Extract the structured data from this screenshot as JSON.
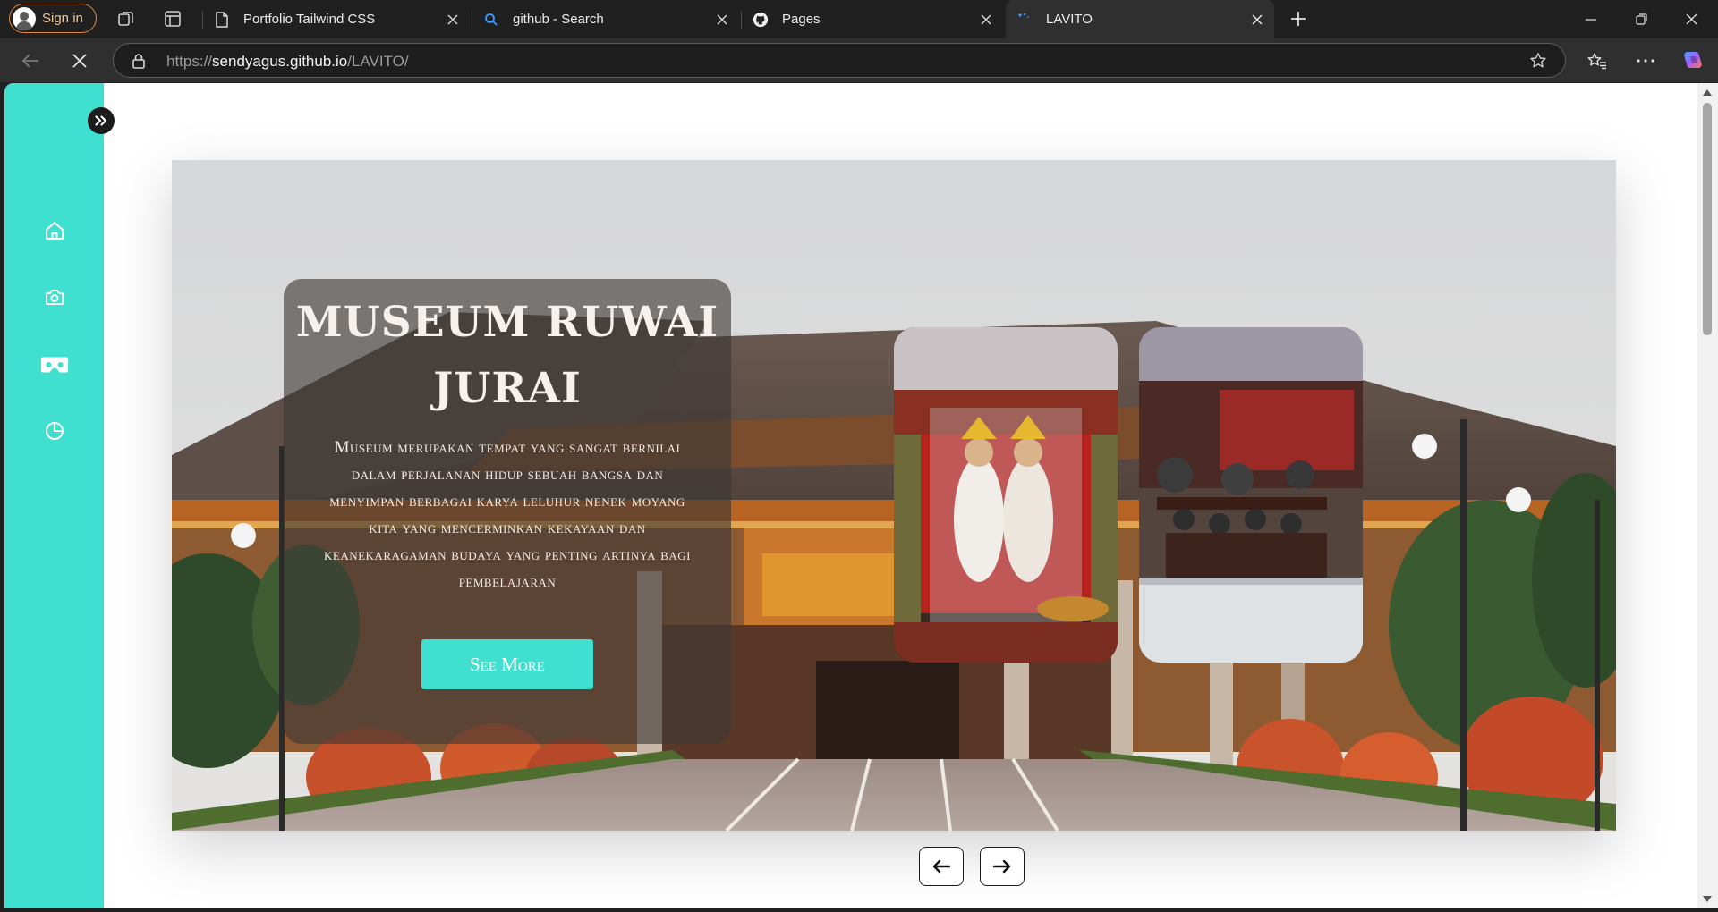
{
  "browser": {
    "signin_label": "Sign in",
    "tabs": [
      {
        "title": "Portfolio Tailwind CSS",
        "favicon": "document-icon"
      },
      {
        "title": "github - Search",
        "favicon": "search-icon"
      },
      {
        "title": "Pages",
        "favicon": "github-icon"
      },
      {
        "title": "LAVITO",
        "favicon": "loading-icon"
      }
    ],
    "url_scheme": "https://",
    "url_host": "sendyagus.github.io",
    "url_path": "/LAVITO/"
  },
  "sidebar": {
    "accent": "#40e0d0",
    "items": [
      {
        "icon": "home-icon"
      },
      {
        "icon": "camera-icon"
      },
      {
        "icon": "vr-headset-icon"
      },
      {
        "icon": "pie-chart-icon"
      }
    ]
  },
  "hero": {
    "title": "Museum Ruwai Jurai",
    "description": "Museum merupakan tempat yang sangat bernilai dalam perjalanan hidup sebuah bangsa dan menyimpan berbagai karya leluhur nenek moyang kita yang mencerminkan kekayaan dan keanekaragaman budaya yang penting artinya bagi pembelajaran",
    "button_label": "See More"
  },
  "pager": {
    "prev_icon": "arrow-left-icon",
    "next_icon": "arrow-right-icon"
  }
}
